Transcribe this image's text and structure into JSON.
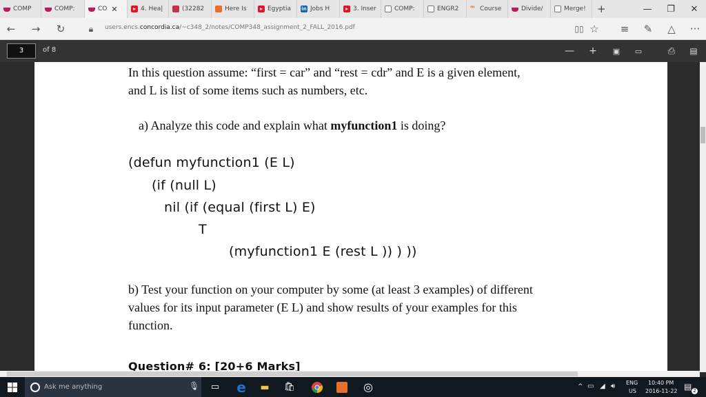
{
  "browser": {
    "tabs": [
      {
        "label": "COMP",
        "icon": "cup-icon"
      },
      {
        "label": "COMP:",
        "icon": "cup-icon"
      },
      {
        "label": "CO",
        "icon": "cup-icon",
        "active": true
      },
      {
        "label": "4. Hea|",
        "icon": "youtube-icon"
      },
      {
        "label": "(32282",
        "icon": "mail-icon"
      },
      {
        "label": "Here Is",
        "icon": "orange-c-icon"
      },
      {
        "label": "Egyptia",
        "icon": "youtube-icon"
      },
      {
        "label": "Jobs H",
        "icon": "linkedin-icon"
      },
      {
        "label": "3. Inser",
        "icon": "youtube-icon"
      },
      {
        "label": "COMP:",
        "icon": "pdf-icon"
      },
      {
        "label": "ENGR2",
        "icon": "pdf-icon"
      },
      {
        "label": "Course",
        "icon": "scribd-icon"
      },
      {
        "label": "Divide/",
        "icon": "cup-icon"
      },
      {
        "label": "Merge!",
        "icon": "pdf-icon"
      }
    ],
    "new_tab": "+",
    "address_url_prefix": "users.encs.",
    "address_url_host": "concordia.ca",
    "address_url_path": "/~c348_2/notes/COMP348_assignment_2_FALL_2016.pdf",
    "active_tab_close": "✕"
  },
  "pdf_toolbar": {
    "current_page": "3",
    "page_of": "of 8"
  },
  "document": {
    "intro_line1": "In this question assume:  “first = car” and “rest = cdr” and E is a given element,",
    "intro_line2": "and L is list of some items such as numbers, etc.",
    "part_a_prefix": "a) Analyze this code and explain what ",
    "part_a_bold": "myfunction1",
    "part_a_suffix": " is doing?",
    "code": [
      "(defun  myfunction1  (E  L)",
      "(if  (null   L)",
      "nil     (if  (equal  (first  L)  E)",
      "T",
      "(myfunction1   E  (rest   L )) ) ))"
    ],
    "part_b_line1": "b) Test your function on your computer by some (at least 3 examples) of different",
    "part_b_line2": "values for its input parameter (E    L)  and show results of your examples for this",
    "part_b_line3": "function.",
    "next_heading": "Question# 6: [20+6 Marks]"
  },
  "taskbar": {
    "search_placeholder": "Ask me anything",
    "lang": "ENG",
    "region": "US",
    "time": "10:40 PM",
    "date": "2016-11-22",
    "notification_count": "2"
  },
  "colors": {
    "tab_bg": "#e6e6e6",
    "pdf_toolbar": "#333333",
    "taskbar": "#101820",
    "edge_blue": "#1e73d2"
  }
}
